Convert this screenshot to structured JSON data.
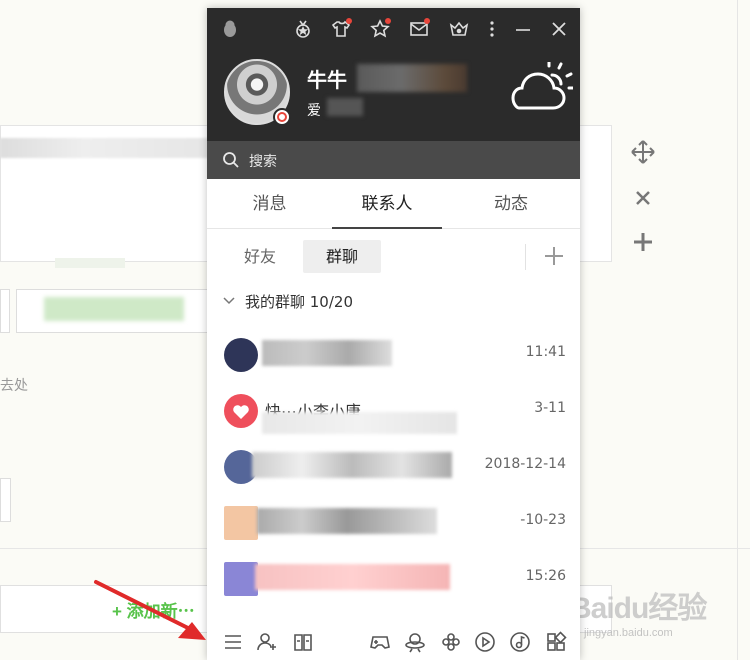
{
  "background": {
    "side_text": "去处",
    "add_new_label": "+ 添加新⋯",
    "tools": {
      "move_icon": "move-icon",
      "close_icon": "close-icon",
      "add_icon": "plus-icon"
    },
    "watermark": {
      "logo": "Baidu经验",
      "url": "jingyan.baidu.com"
    }
  },
  "qq": {
    "title_icons": [
      "penguin-icon",
      "medal-icon",
      "shirt-icon",
      "star-icon",
      "mail-icon",
      "crown-icon",
      "more-icon",
      "minimize-icon",
      "close-icon"
    ],
    "profile": {
      "nickname": "牛牛",
      "signature": "爱",
      "status": "busy"
    },
    "search": {
      "placeholder": "搜索"
    },
    "tabs": [
      "消息",
      "联系人",
      "动态"
    ],
    "active_tab": "联系人",
    "subtabs": [
      "好友",
      "群聊"
    ],
    "active_subtab": "群聊",
    "group": {
      "label": "我的群聊 10/20"
    },
    "rows": [
      {
        "name": "",
        "time": "11:41",
        "avatar_color": "#2e3558"
      },
      {
        "name": "快⋯小李小唐",
        "time": "3-11",
        "avatar_color": "#ef4f5c"
      },
      {
        "name": "",
        "time": "2018-12-14",
        "avatar_color": "#556699"
      },
      {
        "name": "",
        "time": "-10-23",
        "avatar_color": "#f3c6a3"
      },
      {
        "name": "",
        "time": "15:26",
        "avatar_color": "#8a86d6"
      }
    ],
    "bottom_icons": [
      "menu-icon",
      "add-contact-icon",
      "app-manager-icon",
      "game-icon",
      "qzone-icon",
      "pinwheel-icon",
      "video-icon",
      "music-icon",
      "apps-icon"
    ]
  },
  "accent": {
    "brand_dark": "#2b2b2b",
    "alert_red": "#e8463b",
    "green": "#58c34b"
  }
}
